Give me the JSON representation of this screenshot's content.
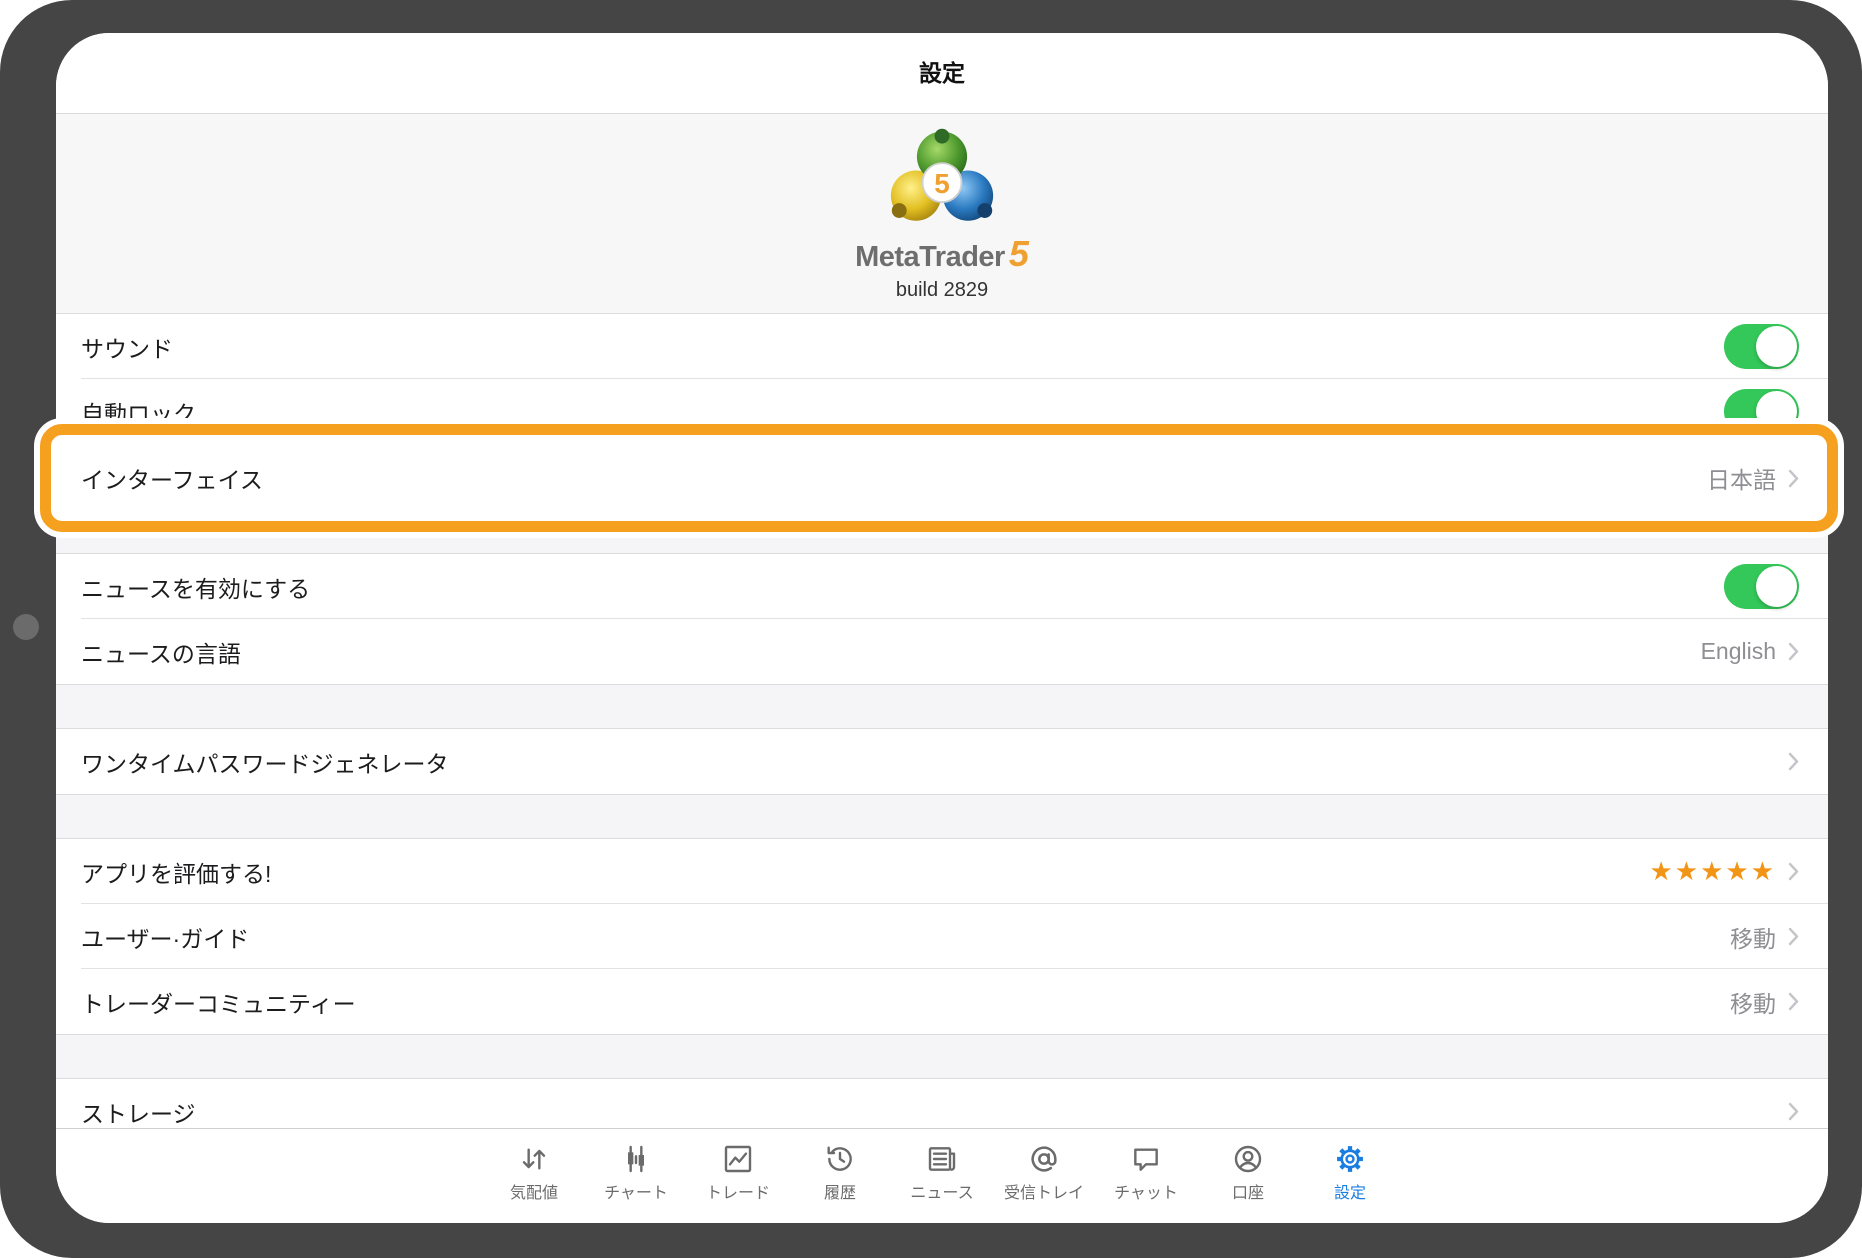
{
  "colors": {
    "accent": "#1a7de0",
    "toggle_on": "#34c759",
    "highlight": "#f5a01e",
    "stars": "#f29416",
    "logo_number": "#f0a030"
  },
  "nav": {
    "title": "設定"
  },
  "header": {
    "logo_badge": "5",
    "brand_name": "MetaTrader",
    "brand_number": "5",
    "build": "build 2829"
  },
  "settings": {
    "sound": {
      "label": "サウンド",
      "enabled": true
    },
    "auto_lock": {
      "label": "自動ロック",
      "enabled": true
    },
    "interface": {
      "label": "インターフェイス",
      "value": "日本語"
    },
    "news_enabled": {
      "label": "ニュースを有効にする",
      "enabled": true
    },
    "news_language": {
      "label": "ニュースの言語",
      "value": "English"
    },
    "otp_generator": {
      "label": "ワンタイムパスワードジェネレータ"
    },
    "rate_app": {
      "label": "アプリを評価する!",
      "stars": "★★★★★"
    },
    "user_guide": {
      "label": "ユーザー·ガイド",
      "value": "移動"
    },
    "trader_community": {
      "label": "トレーダーコミュニティー",
      "value": "移動"
    },
    "storage": {
      "label": "ストレージ"
    }
  },
  "tabs": [
    {
      "label": "気配値",
      "icon": "quotes-icon",
      "active": false
    },
    {
      "label": "チャート",
      "icon": "chart-icon",
      "active": false
    },
    {
      "label": "トレード",
      "icon": "trade-icon",
      "active": false
    },
    {
      "label": "履歴",
      "icon": "history-icon",
      "active": false
    },
    {
      "label": "ニュース",
      "icon": "news-icon",
      "active": false
    },
    {
      "label": "受信トレイ",
      "icon": "inbox-icon",
      "active": false
    },
    {
      "label": "チャット",
      "icon": "chat-icon",
      "active": false
    },
    {
      "label": "口座",
      "icon": "account-icon",
      "active": false
    },
    {
      "label": "設定",
      "icon": "settings-gear-icon",
      "active": true
    }
  ]
}
